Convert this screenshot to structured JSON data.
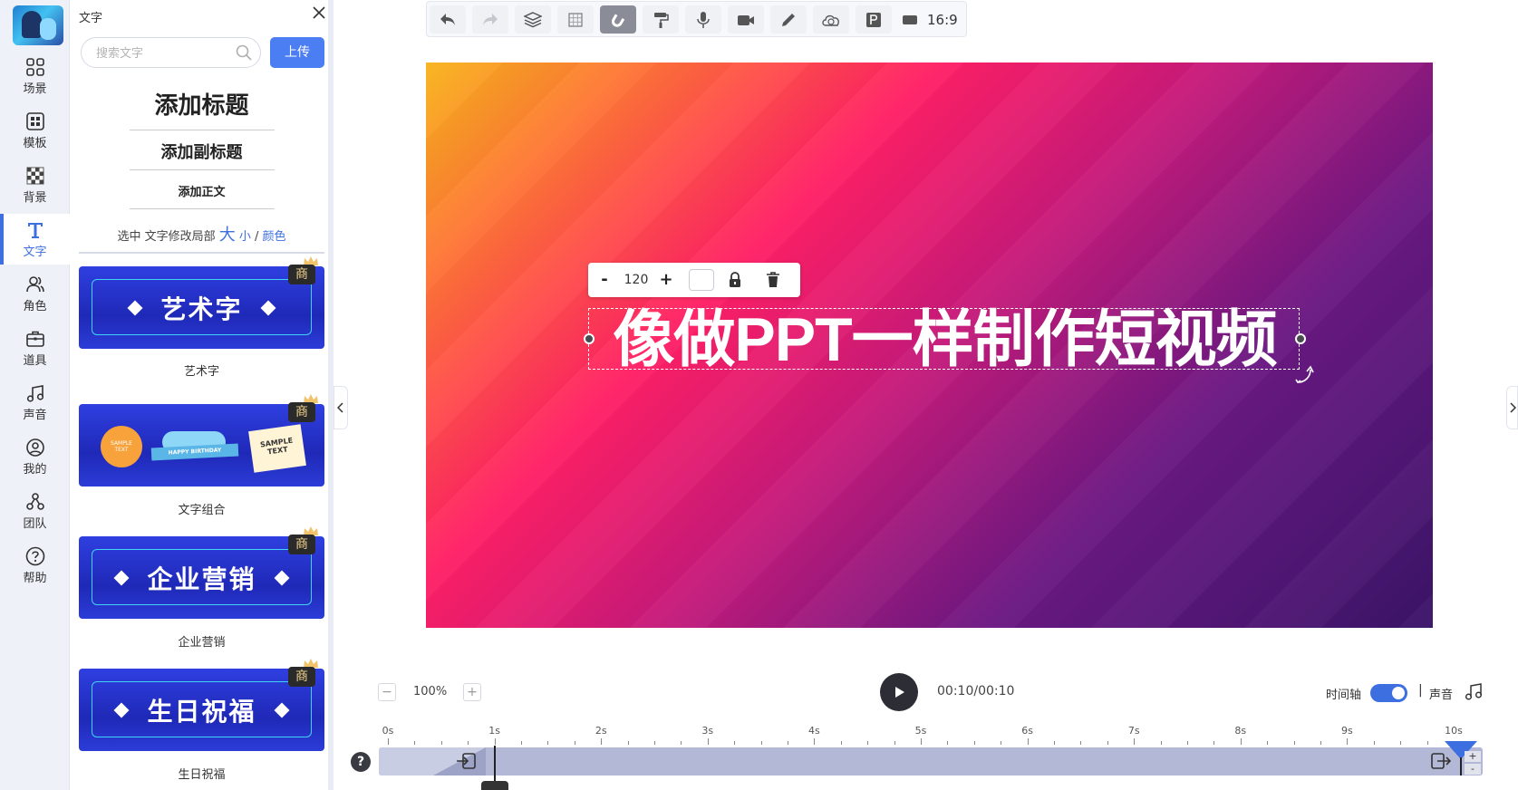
{
  "sidebar": {
    "items": [
      {
        "label": "场景",
        "icon": "grid-icon"
      },
      {
        "label": "模板",
        "icon": "template-icon"
      },
      {
        "label": "背景",
        "icon": "checker-icon"
      },
      {
        "label": "文字",
        "icon": "text-t-icon",
        "active": true
      },
      {
        "label": "角色",
        "icon": "people-icon"
      },
      {
        "label": "道具",
        "icon": "briefcase-icon"
      },
      {
        "label": "声音",
        "icon": "music-note-icon"
      },
      {
        "label": "我的",
        "icon": "user-circle-icon"
      },
      {
        "label": "团队",
        "icon": "team-icon"
      },
      {
        "label": "帮助",
        "icon": "help-circle-icon"
      }
    ]
  },
  "panel": {
    "title": "文字",
    "search_placeholder": "搜索文字",
    "upload_label": "上传",
    "add_title": "添加标题",
    "add_subtitle": "添加副标题",
    "add_body": "添加正文",
    "hint_prefix": "选中 文字修改局部",
    "hint_big": "大",
    "hint_small": "小",
    "hint_sep": "/",
    "hint_color": "颜色",
    "badge_label": "商",
    "cards": [
      {
        "text": "艺术字",
        "label": "艺术字"
      },
      {
        "label": "文字组合",
        "bubble_text": "SAMPLE TEXT",
        "ribbon_text": "HAPPY BIRTHDAY",
        "note_text": "SAMPLE TEXT"
      },
      {
        "text": "企业营销",
        "label": "企业营销"
      },
      {
        "text": "生日祝福",
        "label": "生日祝福"
      }
    ]
  },
  "toolbar": {
    "buttons": [
      "undo-icon",
      "redo-icon",
      "layers-icon",
      "grid-icon",
      "magnet-icon",
      "paint-roller-icon",
      "microphone-icon",
      "video-camera-icon",
      "pen-icon",
      "cloud-save-icon",
      "p-icon",
      "ratio-icon"
    ],
    "ratio": "16:9"
  },
  "canvas": {
    "gradient": [
      "#f8b31b",
      "#ff1f66",
      "#6a1882",
      "#3a1468"
    ],
    "text": "像做PPT一样制作短视频",
    "text_toolbar": {
      "minus": "-",
      "size": "120",
      "plus": "+"
    }
  },
  "playback": {
    "zoom_minus": "−",
    "zoom": "100%",
    "zoom_plus": "+",
    "time": "00:10/00:10",
    "timeline_label": "时间轴",
    "timeline_on": true,
    "divider": "|",
    "sound_label": "声音"
  },
  "timeline": {
    "ticks": [
      "0s",
      "1s",
      "2s",
      "3s",
      "4s",
      "5s",
      "6s",
      "7s",
      "8s",
      "9s",
      "10s"
    ],
    "help": "?",
    "plus": "+",
    "minus": "-",
    "playhead_seconds": 1,
    "accent": "#3e6fe0"
  }
}
